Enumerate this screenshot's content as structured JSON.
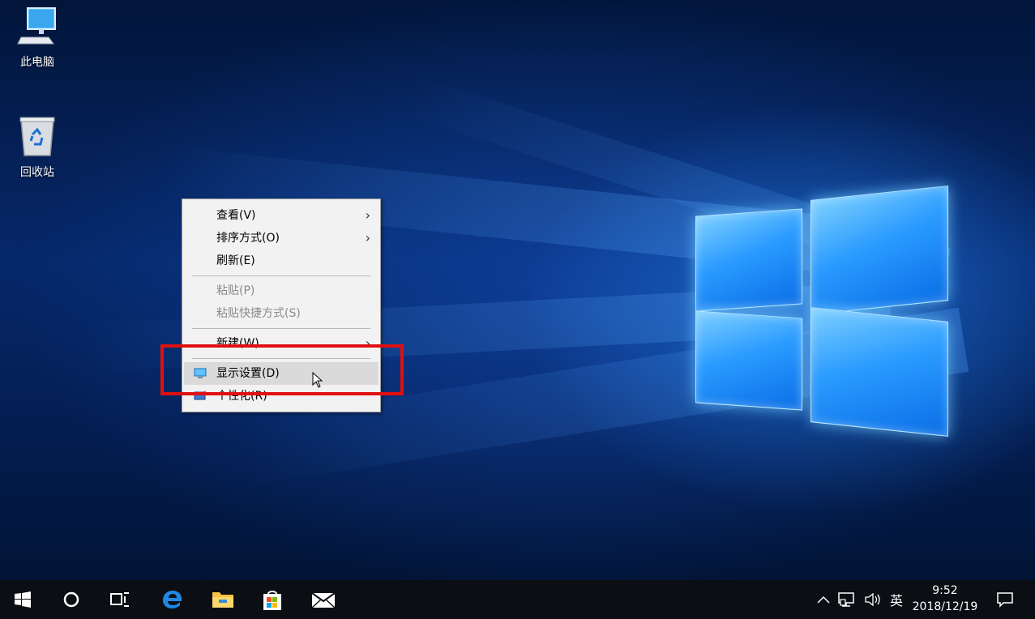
{
  "desktop": {
    "icons": [
      {
        "label": "此电脑",
        "icon": "computer-icon"
      },
      {
        "label": "回收站",
        "icon": "recycle-bin-icon"
      }
    ]
  },
  "context_menu": {
    "items": [
      {
        "label": "查看(V)",
        "submenu": true,
        "enabled": true
      },
      {
        "label": "排序方式(O)",
        "submenu": true,
        "enabled": true
      },
      {
        "label": "刷新(E)",
        "submenu": false,
        "enabled": true
      },
      {
        "label": "粘贴(P)",
        "submenu": false,
        "enabled": false
      },
      {
        "label": "粘贴快捷方式(S)",
        "submenu": false,
        "enabled": false
      },
      {
        "label": "新建(W)",
        "submenu": true,
        "enabled": true
      },
      {
        "label": "显示设置(D)",
        "submenu": false,
        "enabled": true,
        "icon": "display-icon",
        "hovered": true
      },
      {
        "label": "个性化(R)",
        "submenu": false,
        "enabled": true,
        "icon": "personalize-icon"
      }
    ],
    "arrow": "›",
    "highlight_color": "#e01010"
  },
  "taskbar": {
    "buttons": [
      "windows-start-icon",
      "cortana-search-icon",
      "task-view-icon",
      "edge-browser-icon",
      "file-explorer-icon",
      "store-icon",
      "mail-icon"
    ],
    "tray": {
      "chevron": "^",
      "network_icon": "network-icon",
      "volume_icon": "volume-icon",
      "ime": "英",
      "time": "9:52",
      "date": "2018/12/19",
      "notification_icon": "action-center-icon"
    }
  }
}
